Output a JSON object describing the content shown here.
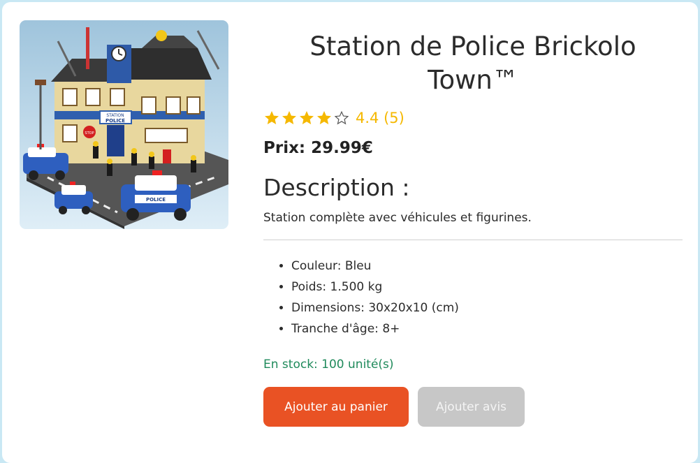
{
  "product": {
    "title": "Station de Police Brickolo Town™",
    "rating_text": "4.4 (5)",
    "rating_value": 4.4,
    "rating_max": 5,
    "price": "Prix: 29.99€",
    "description_heading": "Description :",
    "description": "Station complète avec véhicules et figurines.",
    "specs": [
      "Couleur: Bleu",
      "Poids: 1.500 kg",
      "Dimensions: 30x20x10 (cm)",
      "Tranche d'âge: 8+"
    ],
    "stock": "En stock: 100 unité(s)"
  },
  "actions": {
    "add_to_cart": "Ajouter au panier",
    "add_review": "Ajouter avis"
  },
  "image": {
    "sign_line1": "STATION",
    "sign_line2": "POLICE",
    "car_label": "POLICE",
    "stop_label": "STOP"
  },
  "colors": {
    "accent": "#e95224",
    "star": "#f5b800",
    "stock": "#1f8a5b",
    "disabled": "#c7c7c7"
  }
}
